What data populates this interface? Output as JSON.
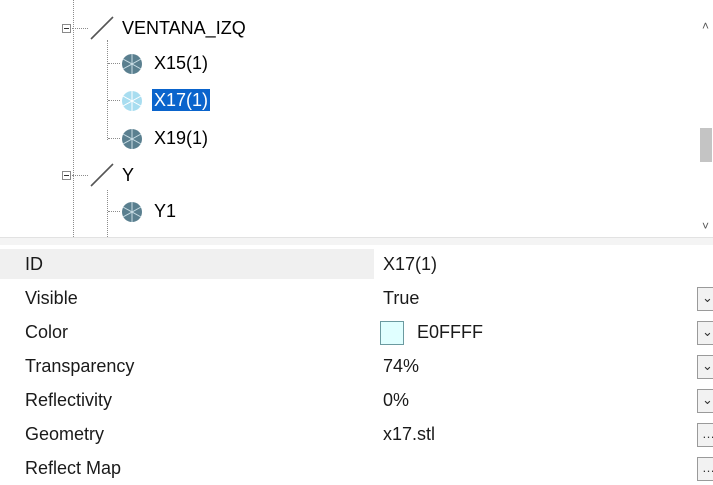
{
  "tree": {
    "nodes": [
      {
        "label": "VENTANA_IZQ",
        "icon": "line-icon",
        "expanded": true
      },
      {
        "label": "X15(1)",
        "icon": "mesh-icon"
      },
      {
        "label": "X17(1)",
        "icon": "mesh-icon-light",
        "selected": true
      },
      {
        "label": "X19(1)",
        "icon": "mesh-icon"
      },
      {
        "label": "Y",
        "icon": "line-icon",
        "expanded": true
      },
      {
        "label": "Y1",
        "icon": "mesh-icon"
      }
    ]
  },
  "properties": [
    {
      "name": "ID",
      "value": "X17(1)",
      "selected": true,
      "button": ""
    },
    {
      "name": "Visible",
      "value": "True",
      "button": "dropdown"
    },
    {
      "name": "Color",
      "value": "E0FFFF",
      "swatch": "#E0FFFF",
      "button": "dropdown"
    },
    {
      "name": "Transparency",
      "value": "74%",
      "button": "dropdown"
    },
    {
      "name": "Reflectivity",
      "value": "0%",
      "button": "dropdown"
    },
    {
      "name": "Geometry",
      "value": "x17.stl",
      "button": "ellipsis"
    },
    {
      "name": "Reflect Map",
      "value": "",
      "button": "ellipsis"
    }
  ],
  "buttons": {
    "dropdown": "⌄",
    "ellipsis": "…"
  },
  "colors": {
    "selection": "#0A64CC",
    "mesh_icon": "#5A7F8F",
    "mesh_icon_light": "#A8DDF0"
  }
}
